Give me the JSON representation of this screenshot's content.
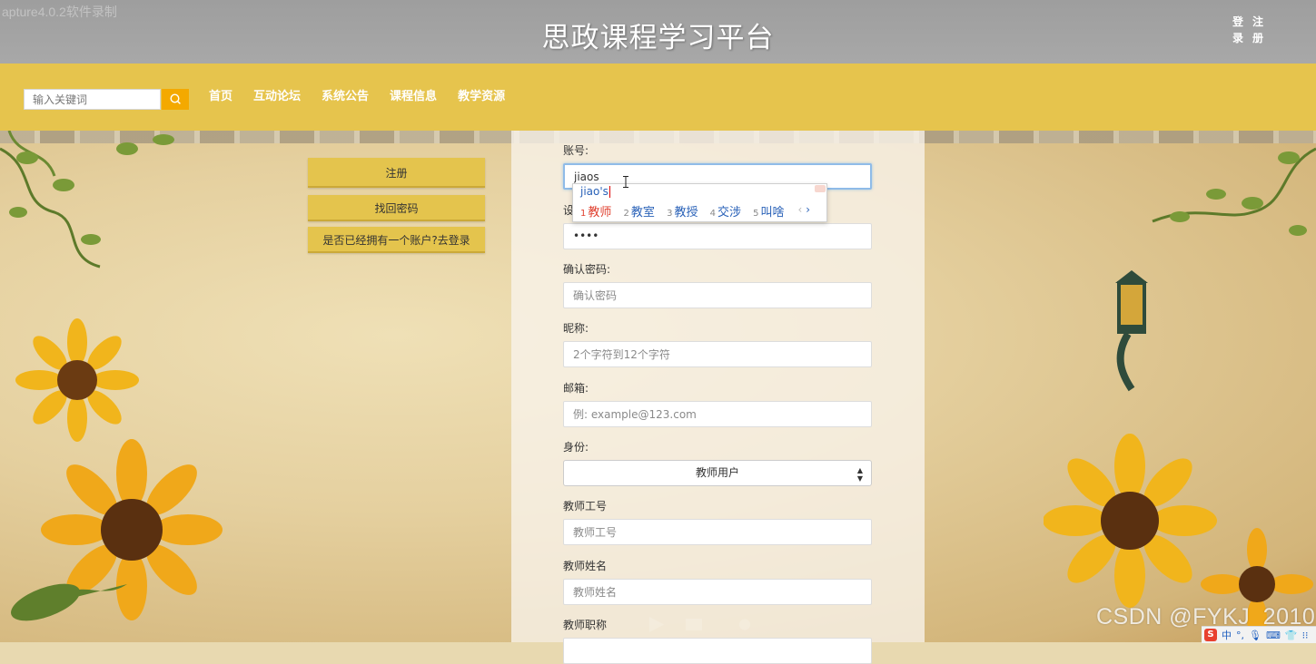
{
  "watermarks": {
    "recorder": "apture4.0.2软件录制",
    "csdn": "CSDN @FYKJ_2010"
  },
  "header": {
    "title": "思政课程学习平台",
    "login": "登录",
    "register": "注册"
  },
  "nav": {
    "search_placeholder": "输入关键词",
    "items": [
      "首页",
      "互动论坛",
      "系统公告",
      "课程信息",
      "教学资源"
    ]
  },
  "sidebar": {
    "buttons": [
      "注册",
      "找回密码",
      "是否已经拥有一个账户?去登录"
    ]
  },
  "form": {
    "fields": [
      {
        "label": "账号:",
        "value": "jiaos",
        "placeholder": ""
      },
      {
        "label": "设置密码:",
        "value": "••••",
        "placeholder": ""
      },
      {
        "label": "确认密码:",
        "value": "",
        "placeholder": "确认密码"
      },
      {
        "label": "昵称:",
        "value": "",
        "placeholder": "2个字符到12个字符"
      },
      {
        "label": "邮箱:",
        "value": "",
        "placeholder": "例: example@123.com"
      },
      {
        "label": "身份:",
        "select_value": "教师用户"
      },
      {
        "label": "教师工号",
        "value": "",
        "placeholder": "教师工号"
      },
      {
        "label": "教师姓名",
        "value": "",
        "placeholder": "教师姓名"
      },
      {
        "label": "教师职称"
      }
    ]
  },
  "ime": {
    "composition": "jiao's",
    "candidates": [
      {
        "num": "1",
        "text": "教师"
      },
      {
        "num": "2",
        "text": "教室"
      },
      {
        "num": "3",
        "text": "教授"
      },
      {
        "num": "4",
        "text": "交涉"
      },
      {
        "num": "5",
        "text": "叫啥"
      }
    ],
    "pager_prev": "‹",
    "pager_next": "›"
  },
  "tray": {
    "logo": "S",
    "lang": "中",
    "punct": "°,"
  },
  "colors": {
    "header_bg": "#a3a3a3",
    "nav_bg": "#e6c44d",
    "search_button": "#f4a900",
    "ime_highlight": "#e0402f",
    "ime_text": "#2a62b8"
  }
}
